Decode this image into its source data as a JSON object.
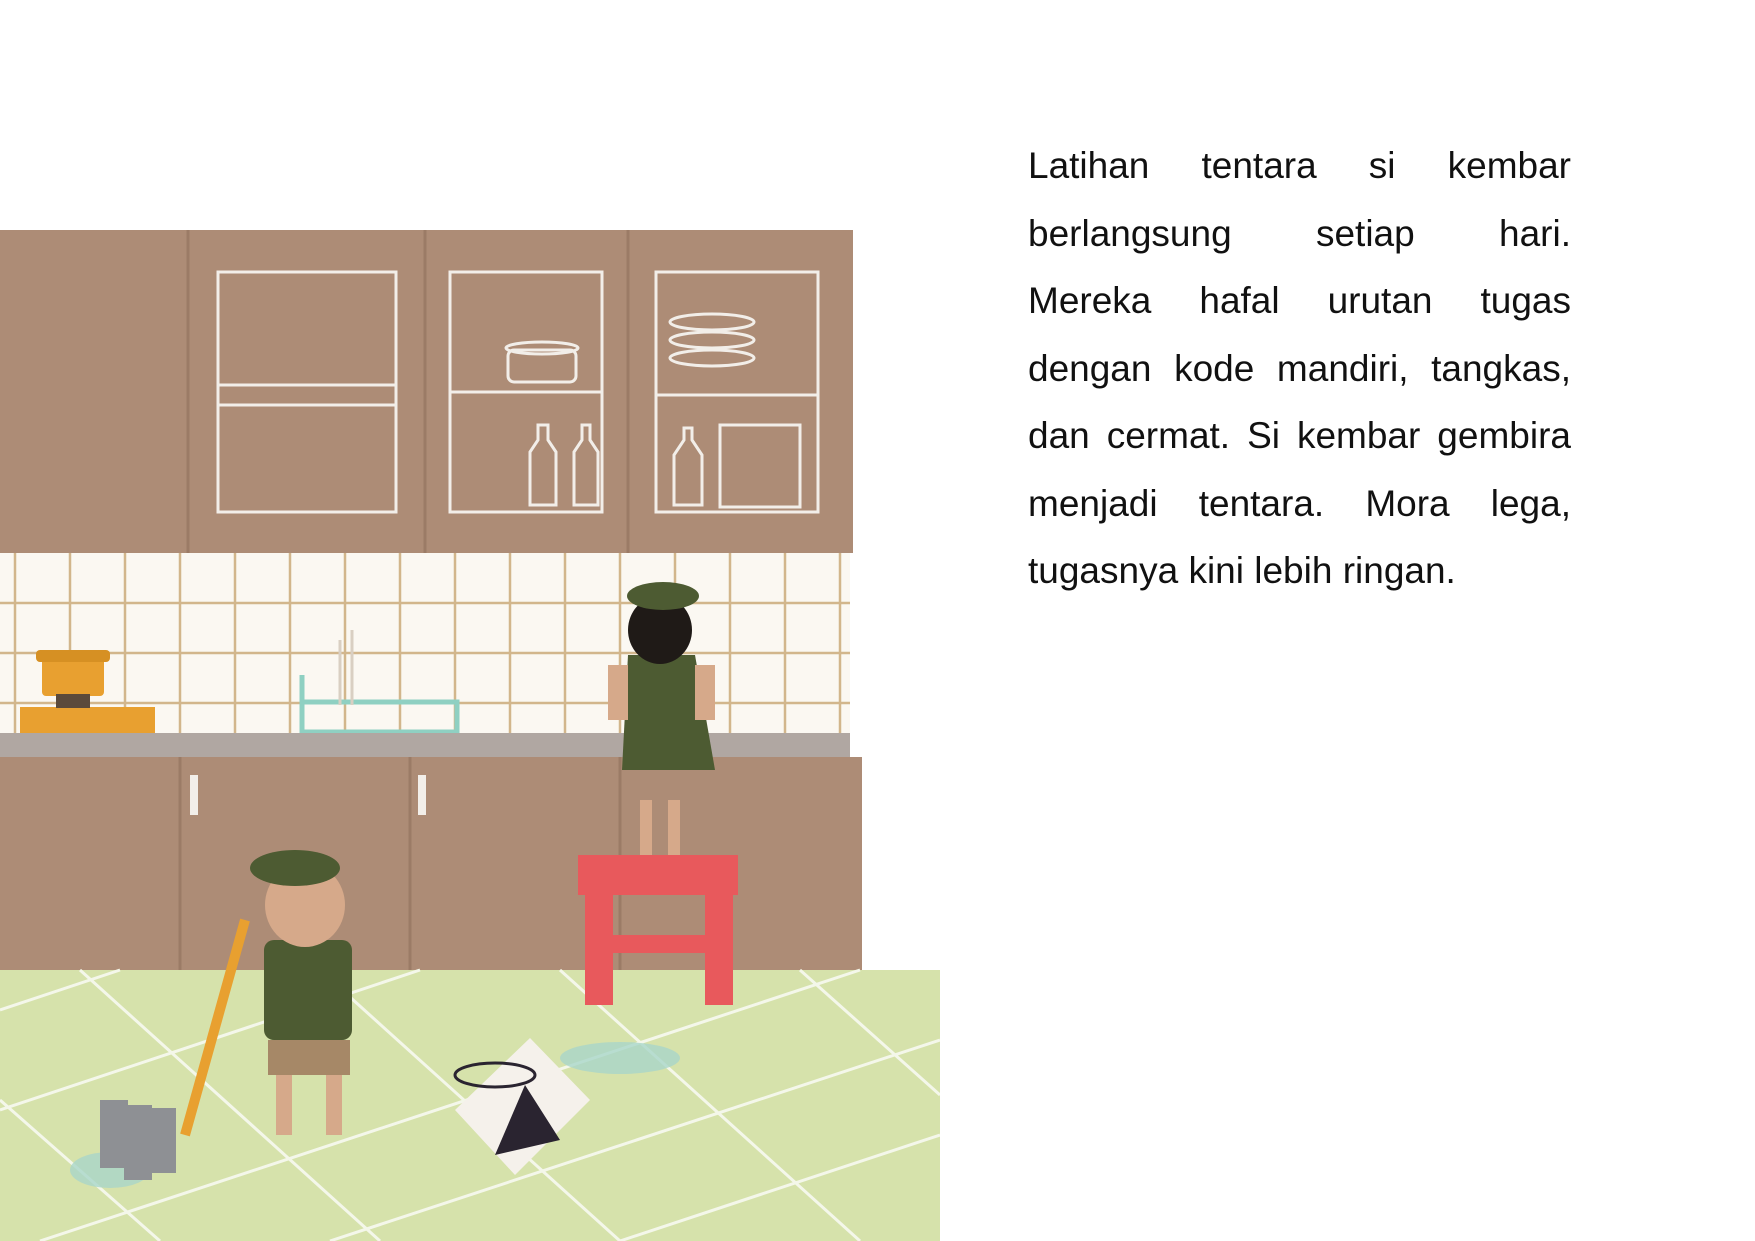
{
  "page": {
    "story_lines": [
      "Latihan tentara si kembar",
      "berlangsung setiap hari.",
      "Mereka hafal urutan tugas",
      "dengan kode mandiri, tangkas,",
      "dan cermat. Si kembar gembira",
      "menjadi tentara. Mora lega,",
      "tugasnya kini lebih ringan."
    ]
  },
  "colors": {
    "cabinet": "#ad8c76",
    "floor": "#d6e2ab",
    "tile_grout": "#d2b68c",
    "uniform": "#4d5b32",
    "stool": "#e8595c"
  }
}
